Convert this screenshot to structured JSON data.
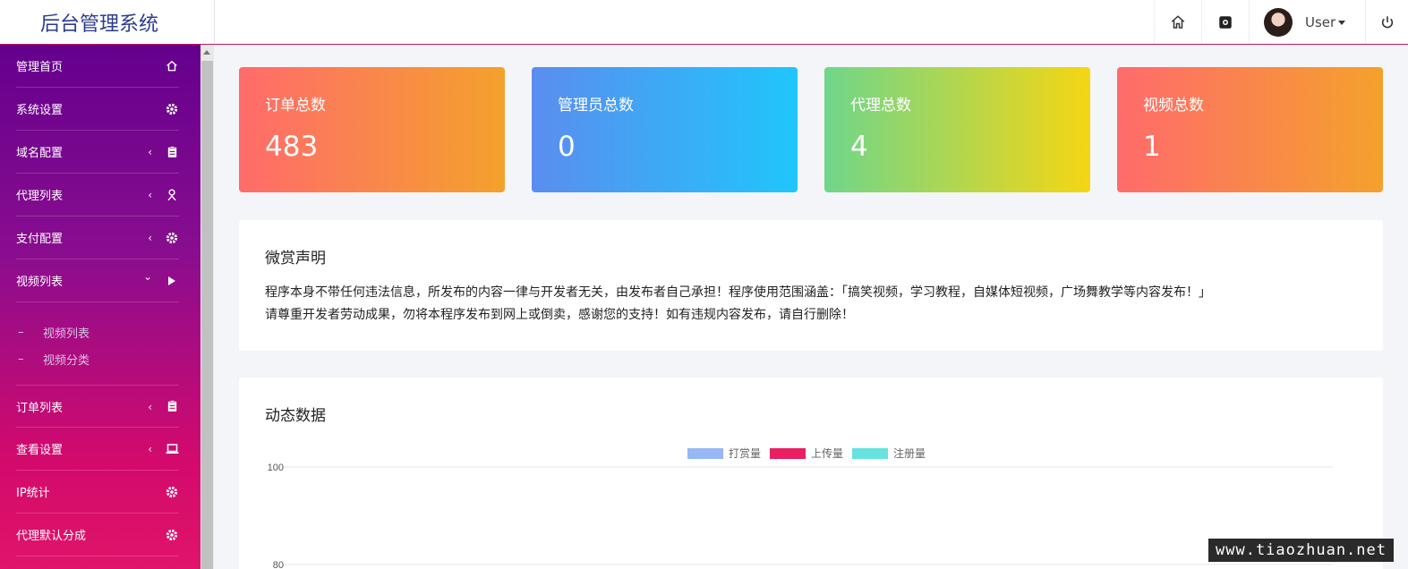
{
  "app": {
    "title": "后台管理系统"
  },
  "header": {
    "user_label": "User",
    "icons": [
      "home-icon",
      "settings-icon",
      "power-icon"
    ]
  },
  "sidebar": {
    "items": [
      {
        "label": "管理首页",
        "icon": "home-icon",
        "arrow": ""
      },
      {
        "label": "系统设置",
        "icon": "gear-icon",
        "arrow": ""
      },
      {
        "label": "域名配置",
        "icon": "clipboard-icon",
        "arrow": "‹"
      },
      {
        "label": "代理列表",
        "icon": "person-icon",
        "arrow": "‹"
      },
      {
        "label": "支付配置",
        "icon": "gear-icon",
        "arrow": "‹"
      },
      {
        "label": "视频列表",
        "icon": "play-icon",
        "arrow": "⌄"
      },
      {
        "label": "订单列表",
        "icon": "clipboard-icon",
        "arrow": "‹"
      },
      {
        "label": "查看设置",
        "icon": "laptop-icon",
        "arrow": "‹"
      },
      {
        "label": "IP统计",
        "icon": "gear-icon",
        "arrow": ""
      },
      {
        "label": "代理默认分成",
        "icon": "gear-icon",
        "arrow": ""
      }
    ],
    "submenu": [
      {
        "dash": "–",
        "label": "视频列表"
      },
      {
        "dash": "–",
        "label": "视频分类"
      }
    ]
  },
  "stats": [
    {
      "title": "订单总数",
      "value": "483",
      "gradient": [
        "#ff6b6b",
        "#f4a12c"
      ]
    },
    {
      "title": "管理员总数",
      "value": "0",
      "gradient": [
        "#5b8def",
        "#1fc6fc"
      ]
    },
    {
      "title": "代理总数",
      "value": "4",
      "gradient": [
        "#6fd68a",
        "#f5d613"
      ]
    },
    {
      "title": "视频总数",
      "value": "1",
      "gradient": [
        "#ff6b6b",
        "#f4a12c"
      ]
    }
  ],
  "notice": {
    "title": "微赏声明",
    "line1": "程序本身不带任何违法信息，所发布的内容一律与开发者无关，由发布者自己承担！程序使用范围涵盖：「搞笑视频，学习教程，自媒体短视频，广场舞教学等内容发布！」",
    "line2": "请尊重开发者劳动成果，勿将本程序发布到网上或倒卖，感谢您的支持！如有违规内容发布，请自行删除！"
  },
  "chart_section": {
    "title": "动态数据"
  },
  "chart_data": {
    "type": "line",
    "series": [
      {
        "name": "打赏量",
        "color": "#97b7f5",
        "values": []
      },
      {
        "name": "上传量",
        "color": "#e91e63",
        "values": []
      },
      {
        "name": "注册量",
        "color": "#66e3de",
        "values": []
      }
    ],
    "yticks": [
      "100",
      "80"
    ],
    "ylim": [
      80,
      100
    ],
    "legend": "top-center",
    "grid": true
  },
  "watermark": "www.tiaozhuan.net"
}
